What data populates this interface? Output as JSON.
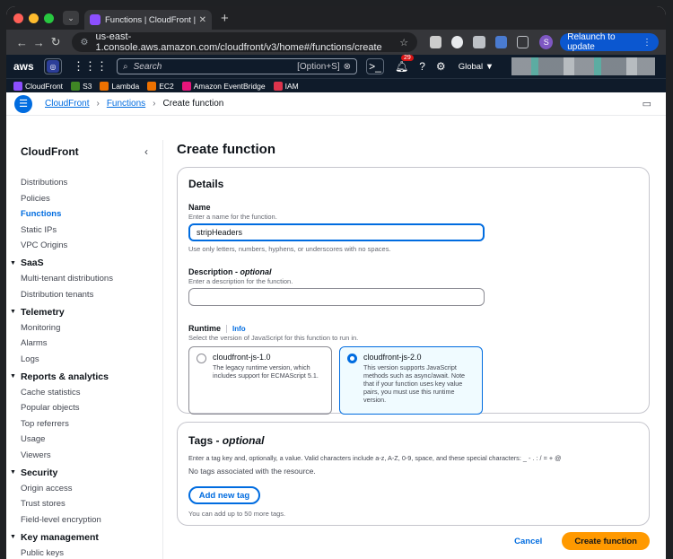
{
  "browser": {
    "tab_title": "Functions | CloudFront | Glob",
    "url": "us-east-1.console.aws.amazon.com/cloudfront/v3/home#/functions/create",
    "relaunch_label": "Relaunch to update",
    "profile_initial": "S"
  },
  "aws": {
    "logo": "aws",
    "search_placeholder": "Search",
    "search_shortcut": "[Option+S]",
    "notification_count": "29",
    "region": "Global ▼",
    "favorites": [
      {
        "label": "CloudFront",
        "color": "#8c4fff"
      },
      {
        "label": "S3",
        "color": "#3f8624"
      },
      {
        "label": "Lambda",
        "color": "#ed7100"
      },
      {
        "label": "EC2",
        "color": "#ed7100"
      },
      {
        "label": "Amazon EventBridge",
        "color": "#e7157b"
      },
      {
        "label": "IAM",
        "color": "#dd344c"
      }
    ]
  },
  "breadcrumb": {
    "items": [
      "CloudFront",
      "Functions"
    ],
    "current": "Create function"
  },
  "sidebar": {
    "title": "CloudFront",
    "top_items": [
      "Distributions",
      "Policies",
      "Functions",
      "Static IPs",
      "VPC Origins"
    ],
    "sections": [
      {
        "title": "SaaS",
        "items": [
          "Multi-tenant distributions",
          "Distribution tenants"
        ]
      },
      {
        "title": "Telemetry",
        "items": [
          "Monitoring",
          "Alarms",
          "Logs"
        ]
      },
      {
        "title": "Reports & analytics",
        "items": [
          "Cache statistics",
          "Popular objects",
          "Top referrers",
          "Usage",
          "Viewers"
        ]
      },
      {
        "title": "Security",
        "items": [
          "Origin access",
          "Trust stores",
          "Field-level encryption"
        ]
      },
      {
        "title": "Key management",
        "items": [
          "Public keys"
        ]
      }
    ]
  },
  "main": {
    "title": "Create function",
    "details": {
      "heading": "Details",
      "name_label": "Name",
      "name_desc": "Enter a name for the function.",
      "name_value": "stripHeaders",
      "name_hint": "Use only letters, numbers, hyphens, or underscores with no spaces.",
      "desc_label": "Description",
      "desc_optional": "optional",
      "desc_desc": "Enter a description for the function.",
      "desc_value": "",
      "runtime_label": "Runtime",
      "runtime_info": "Info",
      "runtime_desc": "Select the version of JavaScript for this function to run in.",
      "runtimes": [
        {
          "title": "cloudfront-js-1.0",
          "desc": "The legacy runtime version, which includes support for ECMAScript 5.1.",
          "selected": false
        },
        {
          "title": "cloudfront-js-2.0",
          "desc": "This version supports JavaScript methods such as async/await. Note that if your function uses key value pairs, you must use this runtime version.",
          "selected": true
        }
      ]
    },
    "tags": {
      "heading": "Tags",
      "heading_optional": "optional",
      "desc": "Enter a tag key and, optionally, a value. Valid characters include a-z, A-Z, 0-9, space, and these special characters: _ - . : / = + @",
      "empty": "No tags associated with the resource.",
      "add_label": "Add new tag",
      "limit": "You can add up to 50 more tags."
    },
    "cancel_label": "Cancel",
    "create_label": "Create function"
  }
}
